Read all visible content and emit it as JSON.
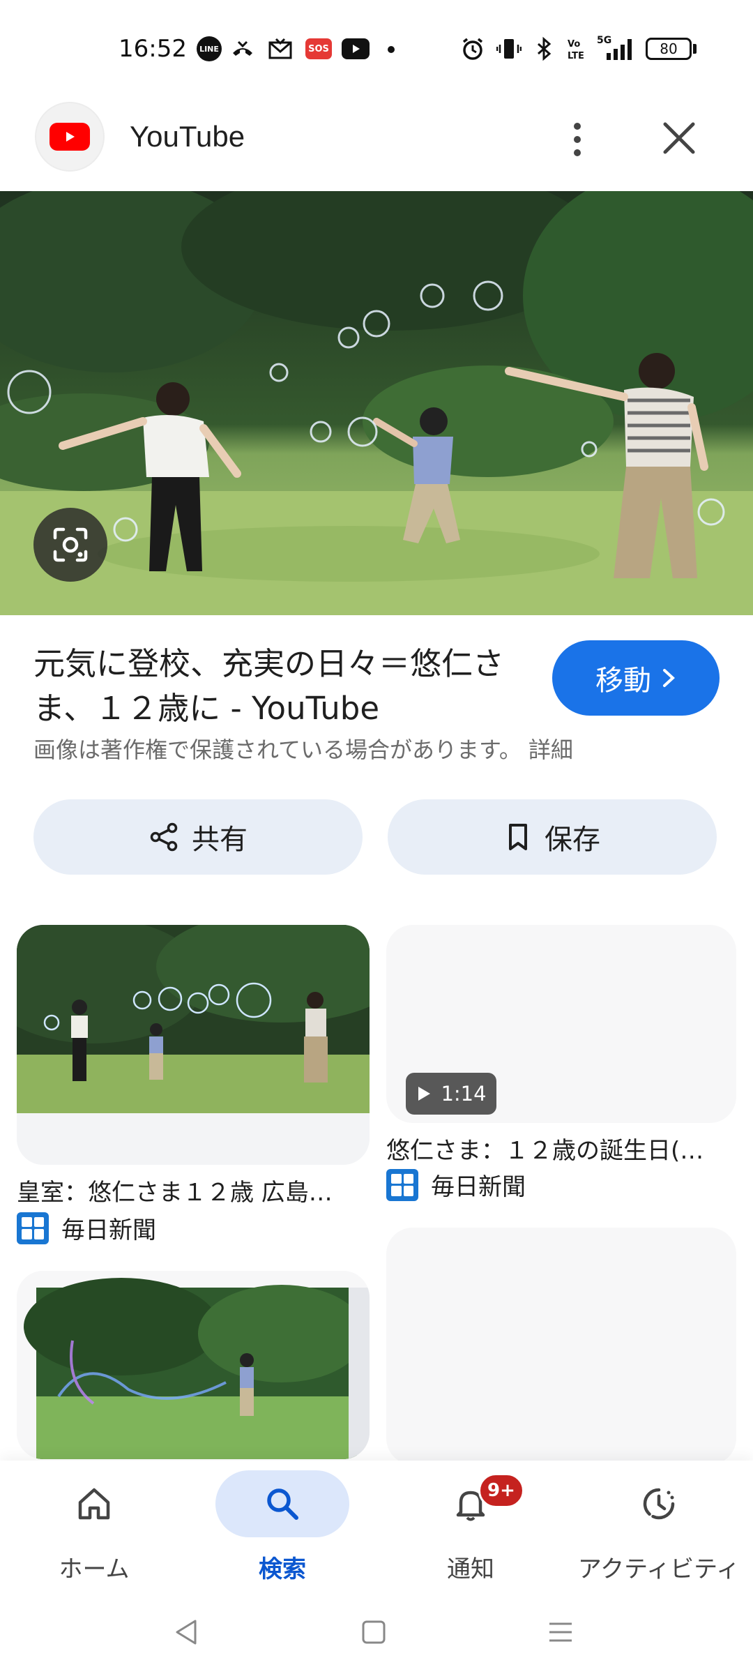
{
  "status_bar": {
    "time": "16:52",
    "line_label": "LINE",
    "sos_label": "SOS",
    "network_label": "5G",
    "battery_level": "80",
    "icons": [
      "line-icon",
      "missed-call-icon",
      "mail-icon",
      "sos-icon",
      "youtube-icon",
      "dot-icon",
      "alarm-icon",
      "vibrate-icon",
      "bluetooth-icon",
      "volte-icon",
      "signal-icon",
      "battery-icon"
    ]
  },
  "header": {
    "title": "YouTube",
    "logo_icon": "youtube-logo-icon",
    "brand_color": "#ff0000"
  },
  "result": {
    "title": "元気に登校、充実の日々＝悠仁さま、１２歳に - YouTube",
    "visit_label": "移動",
    "copyright": "画像は著作権で保護されている場合があります。",
    "details_label": "詳細",
    "accent_color": "#1a73e8"
  },
  "actions": {
    "share_label": "共有",
    "save_label": "保存"
  },
  "related": [
    {
      "title": "皇室：悠仁さま１２歳 広島…",
      "source": "毎日新聞"
    },
    {
      "title": "悠仁さま：１２歳の誕生日(…",
      "source": "毎日新聞",
      "duration": "1:14"
    }
  ],
  "bottom_nav": {
    "items": [
      {
        "label": "ホーム",
        "icon": "home-icon"
      },
      {
        "label": "検索",
        "icon": "search-icon",
        "active": true
      },
      {
        "label": "通知",
        "icon": "bell-icon",
        "badge": "9+"
      },
      {
        "label": "アクティビティ",
        "icon": "activity-icon"
      }
    ]
  }
}
